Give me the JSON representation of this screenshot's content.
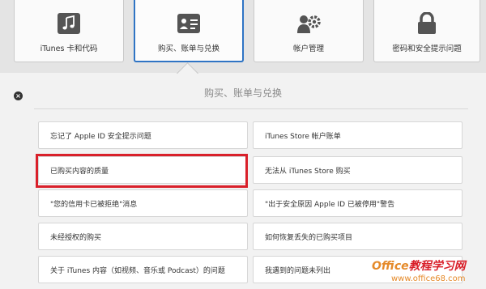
{
  "tabs": [
    {
      "label": "iTunes 卡和代码",
      "icon": "music-note-icon",
      "active": false
    },
    {
      "label": "购买、账单与兑换",
      "icon": "credit-card-icon",
      "active": true
    },
    {
      "label": "帐户管理",
      "icon": "account-gear-icon",
      "active": false
    },
    {
      "label": "密码和安全提示问题",
      "icon": "lock-icon",
      "active": false
    }
  ],
  "section": {
    "title": "购买、账单与兑换",
    "close_label": "×"
  },
  "left_items": [
    "忘记了 Apple ID 安全提示问题",
    "已购买内容的质量",
    "\"您的信用卡已被拒绝\"消息",
    "未经授权的购买",
    "关于 iTunes 内容（如视频、音乐或 Podcast）的问题"
  ],
  "right_items": [
    "iTunes Store 帐户账单",
    "无法从 iTunes Store 购买",
    "\"出于安全原因 Apple ID 已被停用\"警告",
    "如何恢复丢失的已购买项目",
    "我遇到的问题未列出"
  ],
  "watermark": {
    "title_part1": "Office",
    "title_part2": "教程学习网",
    "url": "www.office68.com"
  },
  "colors": {
    "active_tab_border": "#2f74c4",
    "highlight": "#d9202a",
    "icon_bg": "#545454",
    "watermark_orange": "#e58a2a",
    "watermark_red": "#d9202a"
  }
}
